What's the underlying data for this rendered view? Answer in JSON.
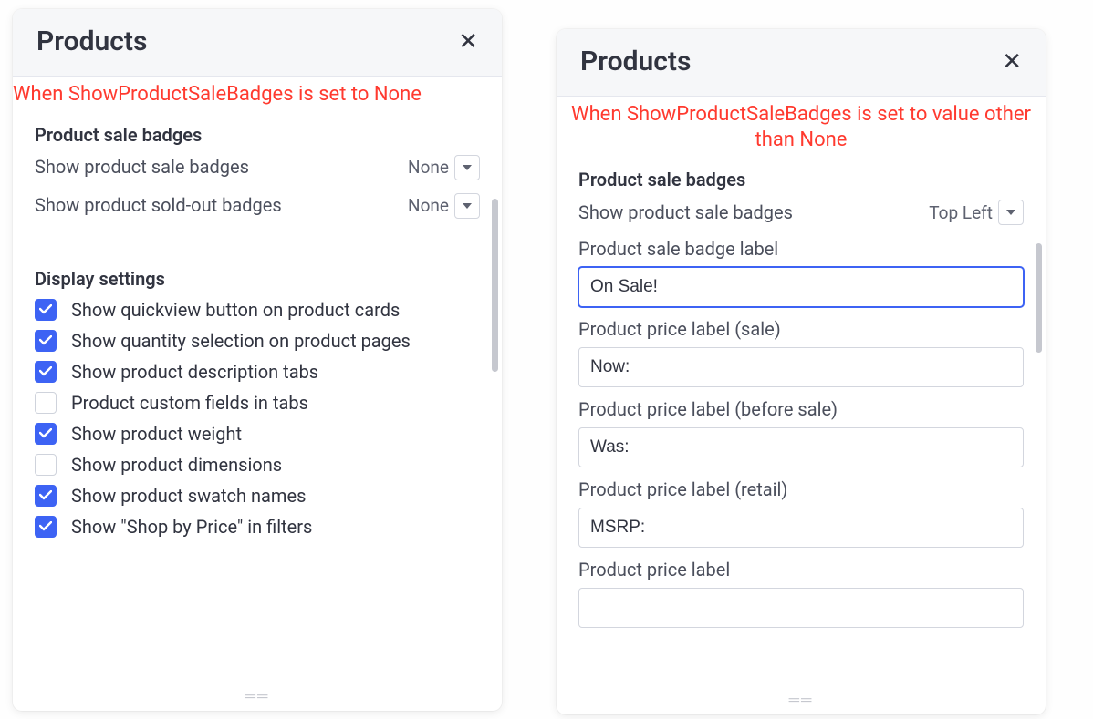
{
  "left": {
    "title": "Products",
    "annotation": "When ShowProductSaleBadges is set to None",
    "section_badges": "Product sale badges",
    "row_sale_badges": "Show product sale badges",
    "row_sale_badges_value": "None",
    "row_soldout_badges": "Show product sold-out badges",
    "row_soldout_badges_value": "None",
    "section_display": "Display settings",
    "checks": [
      {
        "label": "Show quickview button on product cards",
        "checked": true
      },
      {
        "label": "Show quantity selection on product pages",
        "checked": true
      },
      {
        "label": "Show product description tabs",
        "checked": true
      },
      {
        "label": "Product custom fields in tabs",
        "checked": false
      },
      {
        "label": "Show product weight",
        "checked": true
      },
      {
        "label": "Show product dimensions",
        "checked": false
      },
      {
        "label": "Show product swatch names",
        "checked": true
      },
      {
        "label": "Show \"Shop by Price\" in filters",
        "checked": true
      }
    ]
  },
  "right": {
    "title": "Products",
    "annotation": "When ShowProductSaleBadges is set to value other than None",
    "section_badges": "Product sale badges",
    "row_sale_badges": "Show product sale badges",
    "row_sale_badges_value": "Top Left",
    "fields": {
      "badge_label_lbl": "Product sale badge label",
      "badge_label_val": "On Sale!",
      "price_sale_lbl": "Product price label (sale)",
      "price_sale_val": "Now:",
      "price_before_lbl": "Product price label (before sale)",
      "price_before_val": "Was:",
      "price_retail_lbl": "Product price label (retail)",
      "price_retail_val": "MSRP:",
      "price_label_lbl": "Product price label",
      "price_label_val": ""
    }
  },
  "drag_glyph": "══"
}
